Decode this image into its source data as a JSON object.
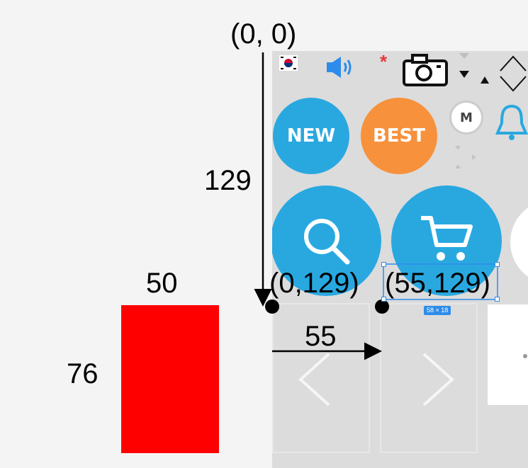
{
  "annotations": {
    "origin_label": "(0, 0)",
    "vertical_offset_label": "129",
    "point_a_label": "(0,129)",
    "point_b_label": "(55,129)",
    "horizontal_offset_label": "55",
    "rect_width_label": "50",
    "rect_height_label": "76",
    "selection_size_badge": "58 × 18"
  },
  "ui": {
    "new_button_label": "NEW",
    "best_button_label": "BEST",
    "m_badge_label": "M"
  },
  "colors": {
    "red_rect": "#ff0000",
    "button_blue": "#29a8e0",
    "button_orange": "#f7913c",
    "selection_blue": "#2d8ceb"
  }
}
